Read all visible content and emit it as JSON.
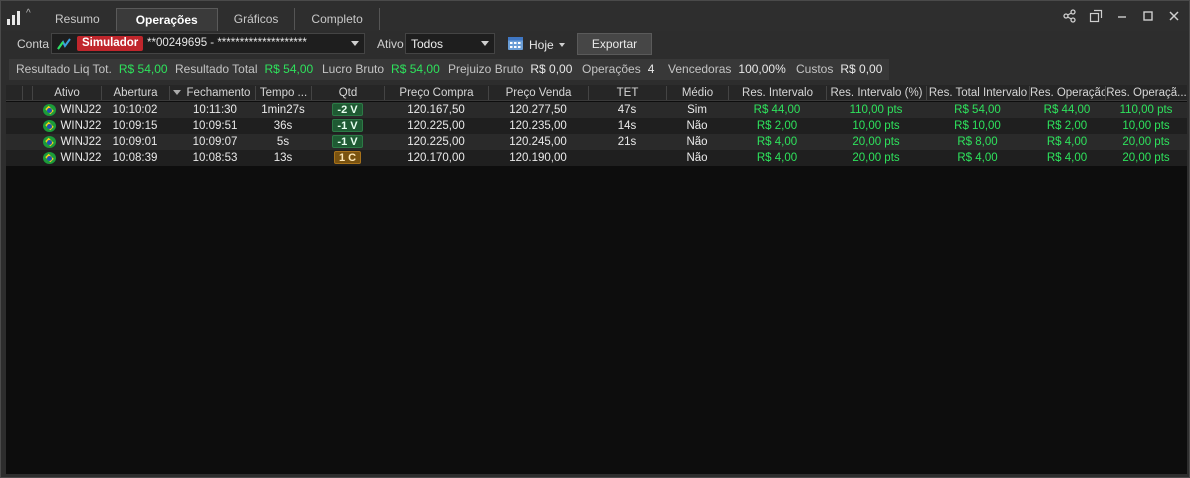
{
  "tabs": [
    {
      "label": "Resumo",
      "active": false
    },
    {
      "label": "Operações",
      "active": true
    },
    {
      "label": "Gráficos",
      "active": false
    },
    {
      "label": "Completo",
      "active": false
    }
  ],
  "window_controls": [
    "share-icon",
    "popout-icon",
    "minimize-icon",
    "maximize-icon",
    "close-icon"
  ],
  "toolbar": {
    "conta_label": "Conta",
    "account_badge": "Simulador",
    "account_text": "**00249695 - ********************",
    "ativo_label": "Ativo",
    "ativo_value": "Todos",
    "date_label": "Hoje",
    "export_label": "Exportar"
  },
  "summary": [
    {
      "key": "Resultado Liq Tot.",
      "value": "R$ 54,00",
      "green": true
    },
    {
      "key": "Resultado Total",
      "value": "R$ 54,00",
      "green": true
    },
    {
      "key": "Lucro Bruto",
      "value": "R$ 54,00",
      "green": true
    },
    {
      "key": "Prejuizo Bruto",
      "value": "R$ 0,00",
      "green": false
    },
    {
      "key": "Operações",
      "value": "4",
      "green": false
    },
    {
      "key": "Vencedoras",
      "value": "100,00%",
      "green": false
    },
    {
      "key": "Custos",
      "value": "R$ 0,00",
      "green": false
    }
  ],
  "columns": [
    "Ativo",
    "Abertura",
    "Fechamento",
    "Tempo ...",
    "Qtd",
    "Preço Compra",
    "Preço Venda",
    "TET",
    "Médio",
    "Res. Intervalo",
    "Res. Intervalo (%)",
    "Res. Total Intervalo",
    "Res. Operação",
    "Res. Operaçã..."
  ],
  "rows": [
    {
      "ativo": "WINJ22",
      "abertura": "10:10:02",
      "fechamento": "10:11:30",
      "tempo": "1min27s",
      "qtd": "-2 V",
      "qtd_side": "v",
      "compra": "120.167,50",
      "venda": "120.277,50",
      "tet": "47s",
      "medio": "Sim",
      "res_int": "R$ 44,00",
      "res_int_pct": "110,00 pts",
      "res_total": "R$ 54,00",
      "res_op": "R$ 44,00",
      "res_op_pts": "110,00 pts"
    },
    {
      "ativo": "WINJ22",
      "abertura": "10:09:15",
      "fechamento": "10:09:51",
      "tempo": "36s",
      "qtd": "-1 V",
      "qtd_side": "v",
      "compra": "120.225,00",
      "venda": "120.235,00",
      "tet": "14s",
      "medio": "Não",
      "res_int": "R$ 2,00",
      "res_int_pct": "10,00 pts",
      "res_total": "R$ 10,00",
      "res_op": "R$ 2,00",
      "res_op_pts": "10,00 pts"
    },
    {
      "ativo": "WINJ22",
      "abertura": "10:09:01",
      "fechamento": "10:09:07",
      "tempo": "5s",
      "qtd": "-1 V",
      "qtd_side": "v",
      "compra": "120.225,00",
      "venda": "120.245,00",
      "tet": "21s",
      "medio": "Não",
      "res_int": "R$ 4,00",
      "res_int_pct": "20,00 pts",
      "res_total": "R$ 8,00",
      "res_op": "R$ 4,00",
      "res_op_pts": "20,00 pts"
    },
    {
      "ativo": "WINJ22",
      "abertura": "10:08:39",
      "fechamento": "10:08:53",
      "tempo": "13s",
      "qtd": "1 C",
      "qtd_side": "c",
      "compra": "120.170,00",
      "venda": "120.190,00",
      "tet": "",
      "medio": "Não",
      "res_int": "R$ 4,00",
      "res_int_pct": "20,00 pts",
      "res_total": "R$ 4,00",
      "res_op": "R$ 4,00",
      "res_op_pts": "20,00 pts"
    }
  ],
  "colors": {
    "positive": "#2ee25c",
    "simulator_badge": "#c0262c",
    "sell_badge": "#1f5a33",
    "buy_badge": "#7a5310"
  }
}
